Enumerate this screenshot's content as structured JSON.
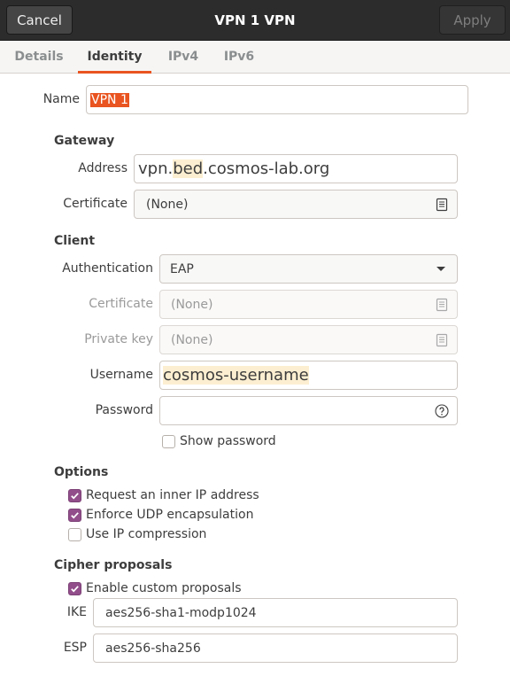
{
  "header": {
    "cancel_label": "Cancel",
    "title": "VPN 1 VPN",
    "apply_label": "Apply"
  },
  "tabs": [
    {
      "label": "Details",
      "active": false
    },
    {
      "label": "Identity",
      "active": true
    },
    {
      "label": "IPv4",
      "active": false
    },
    {
      "label": "IPv6",
      "active": false
    }
  ],
  "name": {
    "label": "Name",
    "value": "VPN 1"
  },
  "gateway": {
    "heading": "Gateway",
    "address_label": "Address",
    "address_value": {
      "pre": "vpn.",
      "highlight": "bed",
      "post": ".cosmos-lab.org"
    },
    "certificate_label": "Certificate",
    "certificate_value": "(None)"
  },
  "client": {
    "heading": "Client",
    "authentication_label": "Authentication",
    "authentication_value": "EAP",
    "certificate_label": "Certificate",
    "certificate_value": "(None)",
    "private_key_label": "Private key",
    "private_key_value": "(None)",
    "username_label": "Username",
    "username_value": "cosmos-username",
    "password_label": "Password",
    "password_value": "",
    "show_password_label": "Show password",
    "show_password_checked": false
  },
  "options": {
    "heading": "Options",
    "items": [
      {
        "label": "Request an inner IP address",
        "checked": true
      },
      {
        "label": "Enforce UDP encapsulation",
        "checked": true
      },
      {
        "label": "Use IP compression",
        "checked": false
      }
    ]
  },
  "cipher": {
    "heading": "Cipher proposals",
    "enable_label": "Enable custom proposals",
    "enable_checked": true,
    "ike_label": "IKE",
    "ike_value": "aes256-sha1-modp1024",
    "esp_label": "ESP",
    "esp_value": "aes256-sha256"
  },
  "colors": {
    "accent": "#e95420",
    "checkbox": "#924d8b",
    "header_bg": "#2c2c2c",
    "highlight": "#fcefd1"
  },
  "icons": {
    "certificate_chooser": "document-open-icon",
    "password_help": "question-circle-icon",
    "combo": "chevron-down-icon"
  }
}
